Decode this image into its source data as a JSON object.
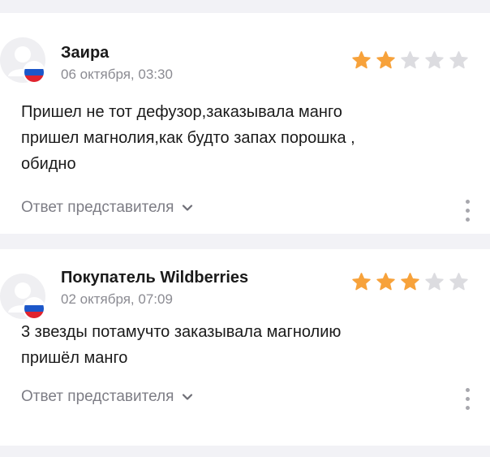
{
  "reviews": [
    {
      "author": "Заира",
      "date": "06 октября, 03:30",
      "rating": 2,
      "max_rating": 5,
      "text_lines": [
        "Пришел не тот дефузор,заказывала манго",
        "пришел магнолия,как будто запах порошка ,",
        "обидно"
      ],
      "reply_label": "Ответ представителя"
    },
    {
      "author": "Покупатель Wildberries",
      "date": "02 октября, 07:09",
      "rating": 3,
      "max_rating": 5,
      "text_lines": [
        "3 звезды потамучто заказывала магнолию",
        "пришёл манго"
      ],
      "reply_label": "Ответ представителя"
    }
  ],
  "colors": {
    "star_filled": "#f7a23b",
    "star_empty": "#dcdce0",
    "background": "#f2f2f6",
    "muted_text": "#8b8b92"
  },
  "icons": {
    "flag": "russia-flag-icon",
    "avatar": "user-avatar-icon",
    "more": "more-vertical-icon",
    "chevron": "chevron-down-icon",
    "star": "star-icon"
  }
}
